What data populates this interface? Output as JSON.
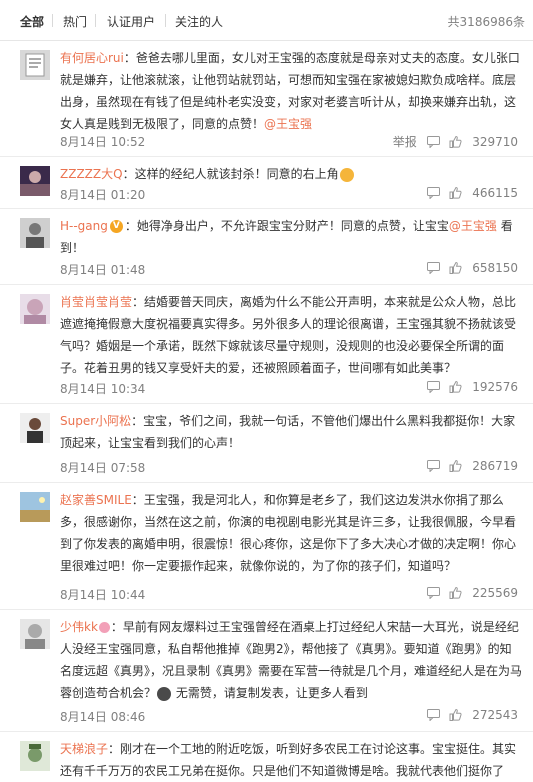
{
  "tabs": [
    "全部",
    "热门",
    "认证用户",
    "关注的人"
  ],
  "total_label": "共3186986条",
  "actions": {
    "report": "举报",
    "reply_icon": "comment-icon",
    "like_icon": "thumbs-up-icon"
  },
  "comments": [
    {
      "username": "有何居心rui",
      "text": "：爸爸去哪儿里面，女儿对王宝强的态度就是母亲对丈夫的态度。女儿张口就是嫌弃，让他滚就滚，让他罚站就罚站，可想而知宝强在家被媳妇欺负成啥样。底层出身，虽然现在有钱了但是纯朴老实没变，对家对老婆言听计从，却换来嫌弃出轨，这女人真是贱到无极限了，同意的点赞！",
      "mention": "@王宝强",
      "date": "8月14日 10:52",
      "likes": "329710",
      "show_report": true
    },
    {
      "username": "ZZZZZ大Q",
      "text": "：这样的经纪人就该封杀！同意的右上角",
      "date": "8月14日 01:20",
      "likes": "466115"
    },
    {
      "username": "H--gang",
      "text": "：她得净身出户，不允许跟宝宝分财产！同意的点赞，让宝宝",
      "mention": "@王宝强",
      "text_after": " 看到！",
      "date": "8月14日 01:48",
      "likes": "658150"
    },
    {
      "username": "肖莹肖莹肖莹",
      "text": "：结婚要普天同庆，离婚为什么不能公开声明，本来就是公众人物，总比遮遮掩掩假意大度祝福要真实得多。另外很多人的理论很离谱，王宝强其貌不扬就该受气吗？婚姻是一个承诺，既然下嫁就该尽量守规则，没规则的也没必要保全所谓的面子。花着丑男的钱又享受奸夫的爱，还被照顾着面子，世间哪有如此美事？",
      "date": "8月14日 10:34",
      "likes": "192576"
    },
    {
      "username": "Super小阿松",
      "text": "：宝宝，爷们之间，我就一句话，不管他们爆出什么黑料我都挺你！大家顶起来，让宝宝看到我们的心声！",
      "date": "8月14日 07:58",
      "likes": "286719"
    },
    {
      "username": "赵家善SMILE",
      "text": "：王宝强，我是河北人，和你算是老乡了，我们这边发洪水你捐了那么多，很感谢你，当然在这之前，你演的电视剧电影光其是许三多，让我很佩服，今早看到了你发表的离婚申明，很震惊！很心疼你，这是你下了多大决心才做的决定啊！你心里很难过吧！你一定要振作起来，就像你说的，为了你的孩子们，知道吗？",
      "date": "8月14日 10:44",
      "likes": "225569"
    },
    {
      "username": "少伟kk",
      "text": "：早前有网友爆料过王宝强曾经在酒桌上打过经纪人宋喆一大耳光，说是经纪人没经王宝强同意，私自帮他推掉《跑男2》，帮他接了《真男》。要知道《跑男》的知名度远超《真男》，况且录制《真男》需要在军营一待就是几个月，难道经纪人是在为马蓉创造苟合机会？",
      "text_after": " 无需赞，请复制发表，让更多人看到",
      "date": "8月14日 08:46",
      "likes": "272543"
    },
    {
      "username": "天梯浪子",
      "text": "：刚才在一个工地的附近吃饭，听到好多农民工在讨论这事。宝宝挺住。其实还有千千万万的农民工兄弟在挺你。只是他们不知道微博是啥。我就代表他们挺你了",
      "date": "",
      "likes": ""
    }
  ]
}
